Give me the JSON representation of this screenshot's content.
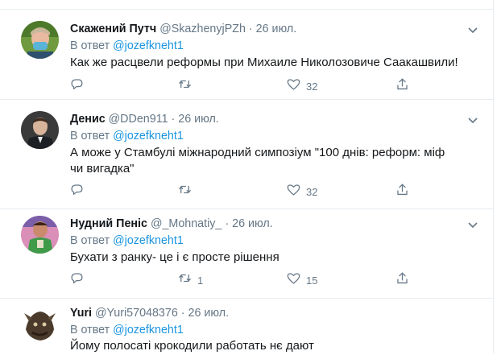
{
  "colors": {
    "accent": "#1b95e0",
    "muted": "#657786",
    "text": "#14171a",
    "border": "#e6ecf0"
  },
  "icons": {
    "reply": "reply-icon",
    "retweet": "retweet-icon",
    "like": "heart-icon",
    "share": "share-icon",
    "more": "chevron-down-icon"
  },
  "tweets": [
    {
      "name": "Скажений Путч",
      "handle": "@SkazhenyjPZh",
      "dot": "·",
      "time": "26 июл.",
      "reply_prefix": "В ответ",
      "reply_to": "@jozefkneht1",
      "text": "Как же расцвели реформы при Михаиле Николозовиче Саакашвили!",
      "replies": "",
      "retweets": "",
      "likes": "32"
    },
    {
      "name": "Денис",
      "handle": "@DDen911",
      "dot": "·",
      "time": "26 июл.",
      "reply_prefix": "В ответ",
      "reply_to": "@jozefkneht1",
      "text": "А може у Стамбулі міжнародний симпозіум \"100 днів: реформ: міф чи вигадка\"",
      "replies": "",
      "retweets": "",
      "likes": "32"
    },
    {
      "name": "Нудний Пеніс",
      "handle": "@_Mohnatiy_",
      "dot": "·",
      "time": "26 июл.",
      "reply_prefix": "В ответ",
      "reply_to": "@jozefkneht1",
      "text": "Бухати з ранку- це і є просте рішення",
      "replies": "",
      "retweets": "1",
      "likes": "15"
    },
    {
      "name": "Yuri",
      "handle": "@Yuri57048376",
      "dot": "·",
      "time": "26 июл.",
      "reply_prefix": "В ответ",
      "reply_to": "@jozefkneht1",
      "text": "Йому полосаті крокодили работать нє дают"
    }
  ]
}
